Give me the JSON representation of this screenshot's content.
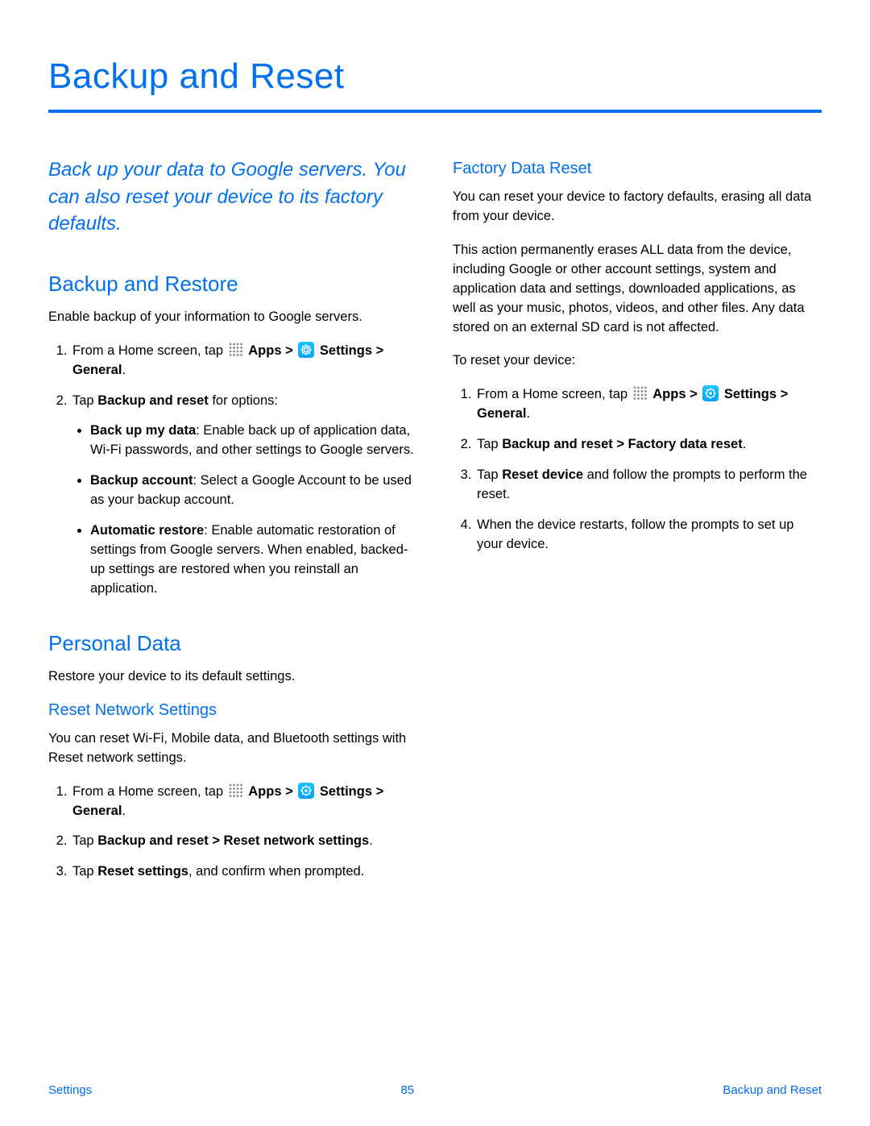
{
  "page": {
    "title": "Backup and Reset",
    "intro": "Back up your data to Google servers. You can also reset your device to its factory defaults."
  },
  "icons": {
    "apps_label": "Apps",
    "settings_label": "Settings",
    "general_suffix": " > General"
  },
  "backup_restore": {
    "heading": "Backup and Restore",
    "lead": "Enable backup of your information to Google servers.",
    "step1_prefix": "From a Home screen, tap ",
    "step1_apps_sep": " > ",
    "step1_period": ".",
    "step2_a": "Tap ",
    "step2_b": "Backup and reset",
    "step2_c": " for options:",
    "bullets": {
      "b1_title": "Back up my data",
      "b1_text": ": Enable back up of application data, Wi-Fi passwords, and other settings to Google servers.",
      "b2_title": "Backup account",
      "b2_text": ": Select a Google Account to be used as your backup account.",
      "b3_title": "Automatic restore",
      "b3_text": ": Enable automatic restoration of settings from Google servers. When enabled, backed-up settings are restored when you reinstall an application."
    }
  },
  "personal_data": {
    "heading": "Personal Data",
    "lead": "Restore your device to its default settings."
  },
  "reset_network": {
    "heading": "Reset Network Settings",
    "lead": "You can reset Wi-Fi, Mobile data, and Bluetooth settings with Reset network settings.",
    "step1_prefix": "From a Home screen, tap ",
    "step1_apps_sep": " > ",
    "step1_period": ".",
    "step2_a": "Tap ",
    "step2_b": "Backup and reset > Reset network settings",
    "step2_c": ".",
    "step3_a": "Tap ",
    "step3_b": "Reset settings",
    "step3_c": ", and confirm when prompted."
  },
  "factory_reset": {
    "heading": "Factory Data Reset",
    "p1": "You can reset your device to factory defaults, erasing all data from your device.",
    "p2": "This action permanently erases ALL data from the device, including Google or other account settings, system and application data and settings, downloaded applications, as well as your music, photos, videos, and other files. Any data stored on an external SD card is not affected.",
    "p3": "To reset your device:",
    "step1_prefix": "From a Home screen, tap ",
    "step1_apps_sep": " > ",
    "step1_period": ".",
    "step2_a": "Tap ",
    "step2_b": "Backup and reset > Factory data reset",
    "step2_c": ".",
    "step3_a": "Tap ",
    "step3_b": "Reset device",
    "step3_c": " and follow the prompts to perform the reset.",
    "step4": "When the device restarts, follow the prompts to set up your device."
  },
  "footer": {
    "left": "Settings",
    "center": "85",
    "right": "Backup and Reset"
  }
}
